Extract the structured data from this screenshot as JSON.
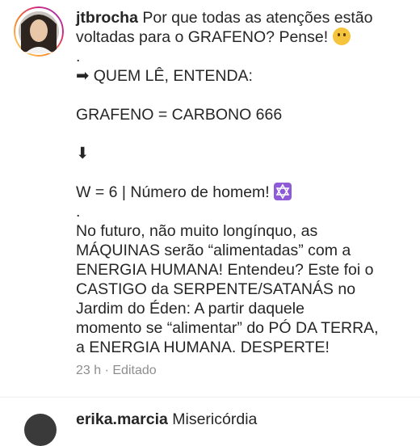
{
  "comment": {
    "username": "jtbrocha",
    "lines": [
      "Por que todas as atenções estão",
      "voltadas para o GRAFENO? Pense!",
      ".",
      "➡ QUEM LÊ, ENTENDA:",
      "",
      "GRAFENO = CARBONO 666",
      "",
      "⬇",
      "",
      "W = 6 | Número de homem!",
      ".",
      "No futuro, não muito longínquo, as",
      "MÁQUINAS serão “alimentadas” com a",
      "ENERGIA HUMANA! Entendeu? Este foi o",
      "CASTIGO da SERPENTE/SATANÁS no",
      "Jardim do Éden: A partir daquele",
      "momento se “alimentar” do PÓ DA TERRA,",
      "a ENERGIA HUMANA. DESPERTE!"
    ],
    "emojis": {
      "thinking": "thinking-face-icon",
      "star": "star-of-david-icon"
    },
    "time": "23 h",
    "separator": "·",
    "edited": "Editado"
  },
  "next_comment": {
    "username": "erika.marcia",
    "text": "Misericórdia"
  },
  "colors": {
    "ring": "#d6249f",
    "meta": "#8e8e8e",
    "text": "#262626"
  }
}
